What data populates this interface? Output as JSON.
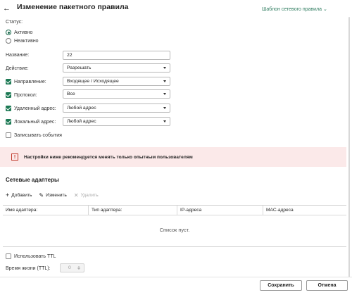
{
  "header": {
    "back_icon": "←",
    "title": "Изменение пакетного правила",
    "template_link": "Шаблон сетевого правила",
    "template_chevron": "⌄"
  },
  "status": {
    "label": "Статус:",
    "options": [
      {
        "label": "Активно",
        "selected": true
      },
      {
        "label": "Неактивно",
        "selected": false
      }
    ]
  },
  "form": {
    "name_label": "Название:",
    "name_value": "22",
    "action_label": "Действие:",
    "action_value": "Разрешать",
    "direction_label": "Направление:",
    "direction_value": "Входящее / Исходящее",
    "protocol_label": "Протокол:",
    "protocol_value": "Все",
    "remote_label": "Удаленный адрес:",
    "remote_value": "Любой адрес",
    "local_label": "Локальный адрес:",
    "local_value": "Любой адрес",
    "log_events_label": "Записывать события"
  },
  "warning": {
    "icon": "!",
    "text": "Настройки ниже рекомендуется менять только опытным пользователям"
  },
  "adapters": {
    "title": "Сетевые адаптеры",
    "add_label": "Добавить",
    "edit_label": "Изменить",
    "delete_label": "Удалить",
    "columns": [
      "Имя адаптера:",
      "Тип адаптера:",
      "IP-адреса",
      "MAC-адреса"
    ],
    "empty_text": "Список пуст."
  },
  "ttl": {
    "use_label": "Использовать TTL",
    "lifetime_label": "Время жизни (TTL):",
    "lifetime_value": "0"
  },
  "footer": {
    "save_label": "Сохранить",
    "cancel_label": "Отмена"
  },
  "colors": {
    "accent": "#1e7a55",
    "link": "#2b7a5d",
    "warning_bg": "#fbe9e9",
    "warning_icon": "#c0392b"
  }
}
